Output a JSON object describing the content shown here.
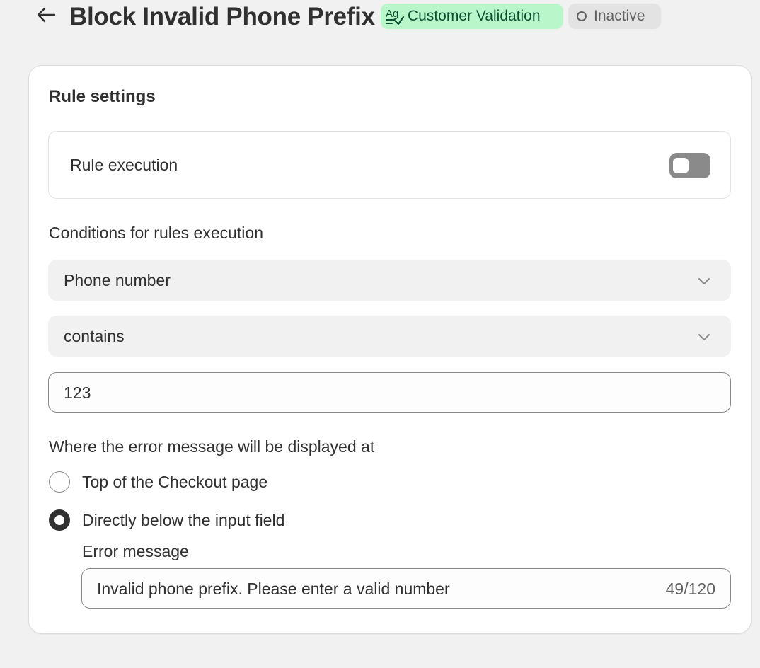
{
  "header": {
    "back_icon": "arrow-left-icon",
    "title": "Block Invalid Phone Prefix",
    "category_badge": {
      "icon": "text-validation-icon",
      "label": "Customer Validation",
      "bg": "#b9f6ca",
      "fg": "#0c5132"
    },
    "status_badge": {
      "icon": "status-circle-icon",
      "label": "Inactive",
      "bg": "#e3e3e3",
      "fg": "#616161"
    }
  },
  "card": {
    "title": "Rule settings",
    "rule_execution": {
      "label": "Rule execution",
      "enabled": false
    },
    "conditions": {
      "label": "Conditions for rules execution",
      "field_select": {
        "value": "Phone number",
        "icon": "chevron-down-icon"
      },
      "operator_select": {
        "value": "contains",
        "icon": "chevron-down-icon"
      },
      "value_input": {
        "value": "123"
      }
    },
    "error_display": {
      "label": "Where the error message will be displayed at",
      "options": [
        {
          "label": "Top of the Checkout page",
          "checked": false
        },
        {
          "label": "Directly below the input field",
          "checked": true
        }
      ],
      "message": {
        "label": "Error message",
        "value": "Invalid phone prefix. Please enter a valid number",
        "counter": "49/120"
      }
    }
  }
}
